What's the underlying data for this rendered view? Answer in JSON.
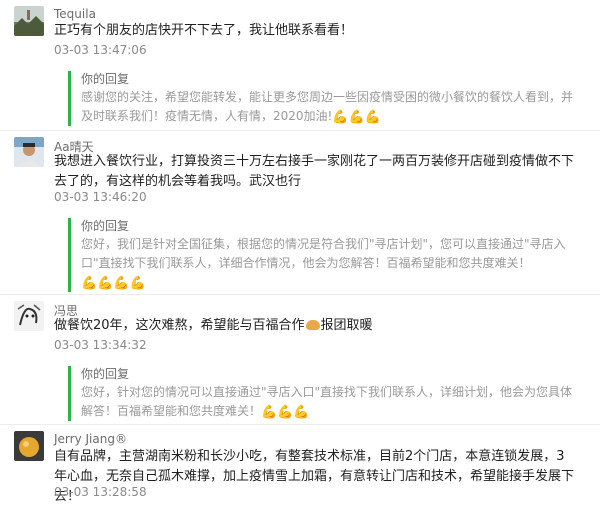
{
  "comments": [
    {
      "name": "Tequila",
      "text": "正巧有个朋友的店快开不下去了，我让他联系看看！",
      "time": "03-03 13:47:06",
      "reply": {
        "label": "你的回复",
        "text": "感谢您的关注，希望您能转发，能让更多您周边一些因疫情受困的微小餐饮的餐饮人看到，并及时联系我们！疫情无情，人有情，2020加油!",
        "emoji": "💪💪💪"
      }
    },
    {
      "name": "Aa晴天",
      "text": "我想进入餐饮行业，打算投资三十万左右接手一家刚花了一两百万装修开店碰到疫情做不下去了的，有这样的机会等着我吗。武汉也行",
      "time": "03-03 13:46:20",
      "reply": {
        "label": "你的回复",
        "text": "您好，我们是针对全国征集，根据您的情况是符合我们\"寻店计划\"，您可以直接通过\"寻店入口\"直接找下我们联系人，详细合作情况，他会为您解答！百福希望能和您共度难关！",
        "emoji": "💪💪💪💪"
      }
    },
    {
      "name": "冯思",
      "text_before": "做餐饮20年，这次难熬，希望能与百福合作",
      "text_after": "报团取暖",
      "time": "03-03 13:34:32",
      "reply": {
        "label": "你的回复",
        "text": "您好，针对您的情况可以直接通过\"寻店入口\"直接找下我们联系人，详细计划，他会为您具体解答！百福希望能和您共度难关！",
        "emoji": "💪💪💪"
      }
    },
    {
      "name": "Jerry Jiang®",
      "text": "自有品牌，主营湖南米粉和长沙小吃，有整套技术标准，目前2个门店，本意连锁发展，3年心血，无奈自己孤木难撑，加上疫情雪上加霜，有意转让门店和技术，希望能接手发展下去！",
      "time": "03-03 13:28:58"
    }
  ],
  "colors": {
    "reply_bar": "#2eb34a",
    "name": "#6b6b6b",
    "time": "#8a8a8a",
    "reply_text": "#9a9a9a"
  },
  "icons": {
    "avatar1": "landscape-avatar",
    "avatar2": "person-avatar",
    "avatar3": "sketch-avatar",
    "avatar4": "orange-avatar",
    "inline": "bread-icon",
    "emoji": "flexed-biceps"
  }
}
